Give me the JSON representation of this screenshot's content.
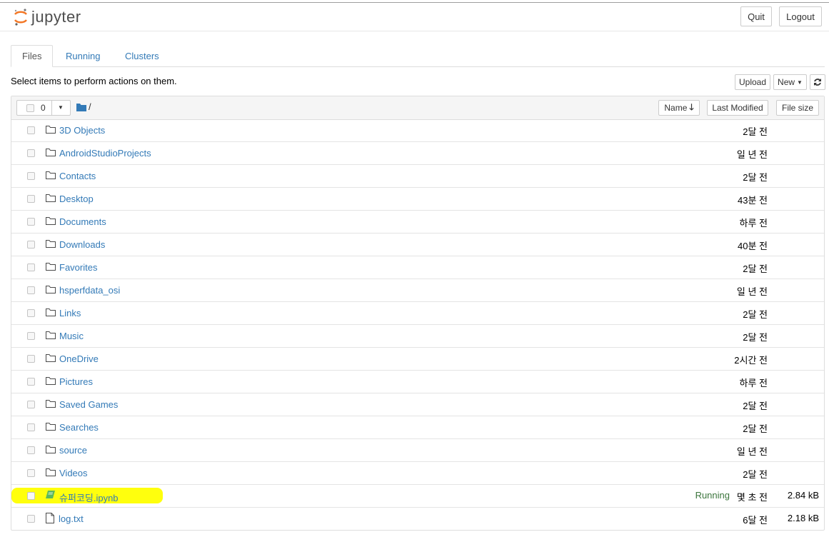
{
  "header": {
    "logo_text": "jupyter",
    "quit_label": "Quit",
    "logout_label": "Logout"
  },
  "tabs": [
    {
      "label": "Files",
      "active": true
    },
    {
      "label": "Running",
      "active": false
    },
    {
      "label": "Clusters",
      "active": false
    }
  ],
  "toolbar": {
    "hint": "Select items to perform actions on them.",
    "upload_label": "Upload",
    "new_label": "New",
    "refresh_icon": "refresh-icon"
  },
  "list_header": {
    "selected_count": "0",
    "path": "/",
    "sort_name_label": "Name",
    "sort_modified_label": "Last Modified",
    "sort_size_label": "File size"
  },
  "rows": [
    {
      "type": "folder",
      "name": "3D Objects",
      "modified": "2달 전",
      "size": "",
      "status": ""
    },
    {
      "type": "folder",
      "name": "AndroidStudioProjects",
      "modified": "일 년 전",
      "size": "",
      "status": ""
    },
    {
      "type": "folder",
      "name": "Contacts",
      "modified": "2달 전",
      "size": "",
      "status": ""
    },
    {
      "type": "folder",
      "name": "Desktop",
      "modified": "43분 전",
      "size": "",
      "status": ""
    },
    {
      "type": "folder",
      "name": "Documents",
      "modified": "하루 전",
      "size": "",
      "status": ""
    },
    {
      "type": "folder",
      "name": "Downloads",
      "modified": "40분 전",
      "size": "",
      "status": ""
    },
    {
      "type": "folder",
      "name": "Favorites",
      "modified": "2달 전",
      "size": "",
      "status": ""
    },
    {
      "type": "folder",
      "name": "hsperfdata_osi",
      "modified": "일 년 전",
      "size": "",
      "status": ""
    },
    {
      "type": "folder",
      "name": "Links",
      "modified": "2달 전",
      "size": "",
      "status": ""
    },
    {
      "type": "folder",
      "name": "Music",
      "modified": "2달 전",
      "size": "",
      "status": ""
    },
    {
      "type": "folder",
      "name": "OneDrive",
      "modified": "2시간 전",
      "size": "",
      "status": ""
    },
    {
      "type": "folder",
      "name": "Pictures",
      "modified": "하루 전",
      "size": "",
      "status": ""
    },
    {
      "type": "folder",
      "name": "Saved Games",
      "modified": "2달 전",
      "size": "",
      "status": ""
    },
    {
      "type": "folder",
      "name": "Searches",
      "modified": "2달 전",
      "size": "",
      "status": ""
    },
    {
      "type": "folder",
      "name": "source",
      "modified": "일 년 전",
      "size": "",
      "status": ""
    },
    {
      "type": "folder",
      "name": "Videos",
      "modified": "2달 전",
      "size": "",
      "status": ""
    },
    {
      "type": "notebook",
      "name": "슈퍼코딩.ipynb",
      "modified": "몇 초 전",
      "size": "2.84 kB",
      "status": "Running",
      "highlighted": true
    },
    {
      "type": "file",
      "name": "log.txt",
      "modified": "6달 전",
      "size": "2.18 kB",
      "status": ""
    }
  ],
  "colors": {
    "link": "#337ab7",
    "running": "#3c763d",
    "highlight": "#ffff00",
    "notebook_icon": "#5cb85c",
    "folder_icon": "#4a4a4a",
    "logo_orange": "#f37726"
  }
}
